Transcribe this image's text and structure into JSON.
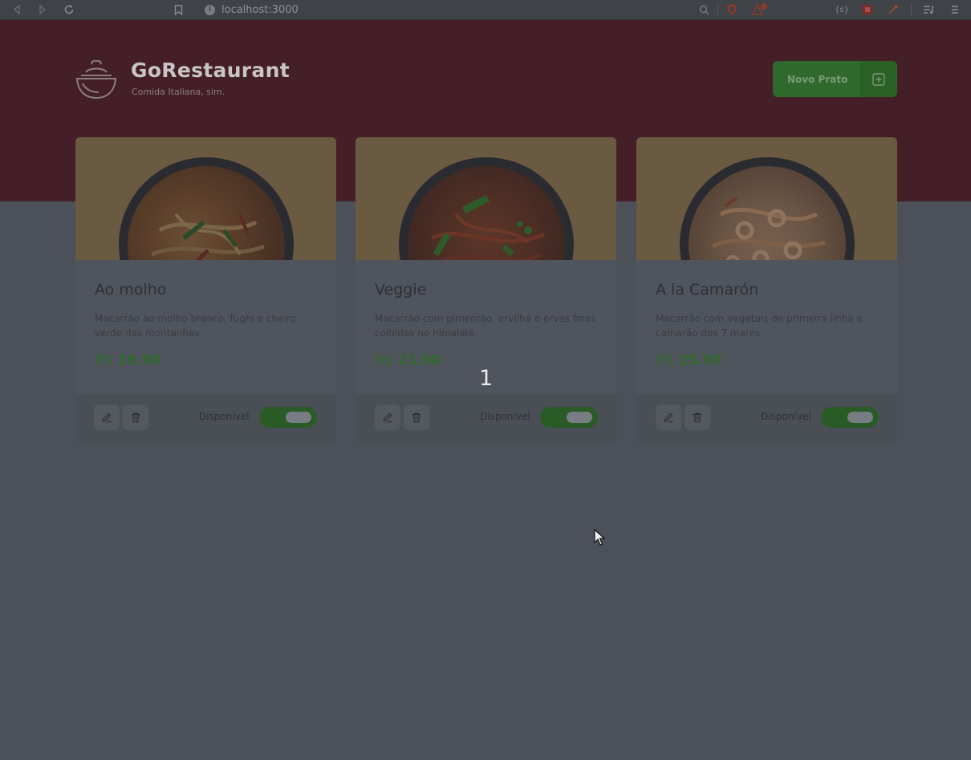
{
  "browser": {
    "url": "localhost:3000",
    "ext_label": "{s}"
  },
  "header": {
    "title": "GoRestaurant",
    "subtitle": "Comida Italiana, sim.",
    "new_button_label": "Novo Prato"
  },
  "foods": [
    {
      "name": "Ao molho",
      "description": "Macarrão ao molho branco, fughi e cheiro verde das montanhas.",
      "currency": "R$",
      "price": "19.90",
      "available_label": "Disponível",
      "available": true
    },
    {
      "name": "Veggie",
      "description": "Macarrão com pimentão, ervilha e ervas finas colhidas no himalaia.",
      "currency": "R$",
      "price": "21.90",
      "available_label": "Disponível",
      "available": true
    },
    {
      "name": "A la Camarón",
      "description": "Macarrão com vegetais de primeira linha e camarão dos 7 mares.",
      "currency": "R$",
      "price": "25.90",
      "available_label": "Disponível",
      "available": true
    }
  ],
  "overlay": {
    "step_number": "1"
  },
  "colors": {
    "header_bg": "#441f27",
    "page_bg": "#4c5059",
    "accent_green": "#2f6a2c",
    "card_image_bg": "#6a5a41"
  },
  "icons": {
    "logo": "food-bowl-icon",
    "new_button": "add-square-icon",
    "edit": "pencil-icon",
    "delete": "trash-icon"
  }
}
